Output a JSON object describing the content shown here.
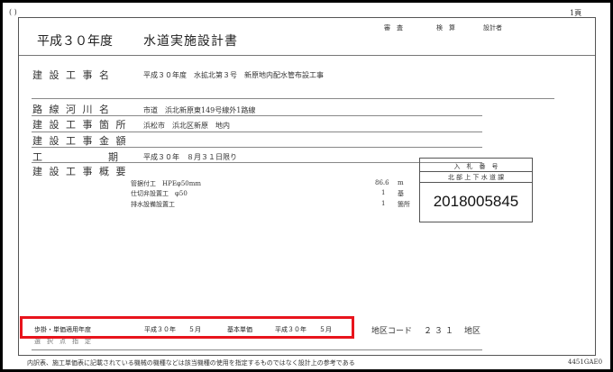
{
  "page": {
    "paren": "(                    )",
    "page_no": "1頁"
  },
  "header": {
    "era": "平成３０年度",
    "title": "水道実施設計書",
    "review": "審　査",
    "check": "検　算",
    "designer": "設計者"
  },
  "fields": {
    "construction_name_label": "建 設 工 事 名",
    "construction_name_value": "平成３０年度　水拡北第３号　新原地内配水管布設工事",
    "road_river_label": "路 線 河 川 名",
    "road_river_value": "市道　浜北新原東149号線外1路線",
    "location_label": "建 設 工 事 箇 所",
    "location_value": "浜松市　浜北区新原　地内",
    "amount_label": "建 設 工 事 金 額",
    "period_label_a": "工",
    "period_label_b": "期",
    "period_value": "平成３０年　８月３１日限り",
    "summary_label": "建 設 工 事 概 要"
  },
  "summary_items": [
    {
      "name": "管据付工　HPEφ50mm",
      "qty": "86.6",
      "unit": "m"
    },
    {
      "name": "仕切弁設置工　φ50",
      "qty": "1",
      "unit": "基"
    },
    {
      "name": "排水設備設置工",
      "qty": "1",
      "unit": "箇所"
    }
  ],
  "bid": {
    "label": "入　札　番　号",
    "dept": "北 部 上 下 水 道 課",
    "number": "2018005845"
  },
  "bottom": {
    "rate_label": "歩掛・単価適用年度",
    "rate_year": "平成３０年　　５月",
    "base_price_label": "基本単価",
    "base_year": "平成３０年　　５月",
    "district_label": "地区コード",
    "district_code": "２３１",
    "district_suffix": "地区",
    "hidden_label": "選　択　点　指　定"
  },
  "footer": {
    "note": "内訳表、施工単価表に記載されている機械の機種などは該当機種の使用を指定するものではなく設計上の参考である",
    "code": "4451GAE0"
  }
}
